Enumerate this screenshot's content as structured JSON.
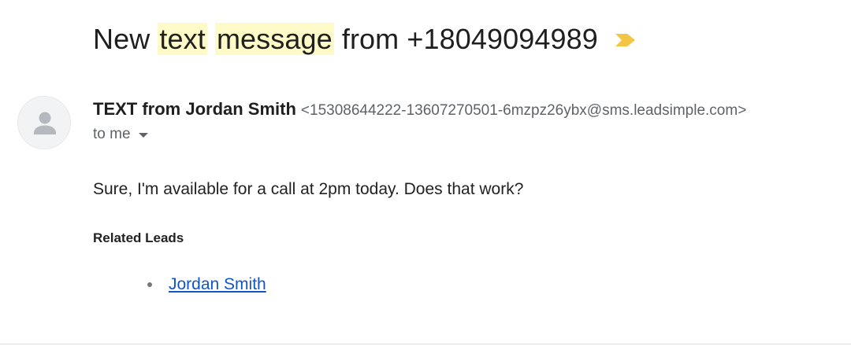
{
  "email": {
    "subject": {
      "prefix": "New ",
      "highlight_1": "text",
      "space": " ",
      "highlight_2": "message",
      "suffix": " from +18049094989"
    },
    "importance_marker": {
      "icon": "importance-marker-icon",
      "color": "#f4c542"
    },
    "sender": {
      "name": "TEXT from Jordan Smith",
      "email": "<15308644222-13607270501-6mzpz26ybx@sms.leadsimple.com>"
    },
    "recipient": {
      "label": "to me",
      "icon": "chevron-down-icon"
    },
    "avatar": {
      "icon": "person-icon"
    },
    "body": "Sure, I'm available for a call at 2pm today. Does that work?",
    "related_leads": {
      "heading": "Related Leads",
      "items": [
        {
          "name": "Jordan Smith"
        }
      ]
    }
  },
  "colors": {
    "highlight": "#fffbc8",
    "link": "#1155cc",
    "importance": "#f4c542",
    "secondary_text": "#5f6368"
  }
}
